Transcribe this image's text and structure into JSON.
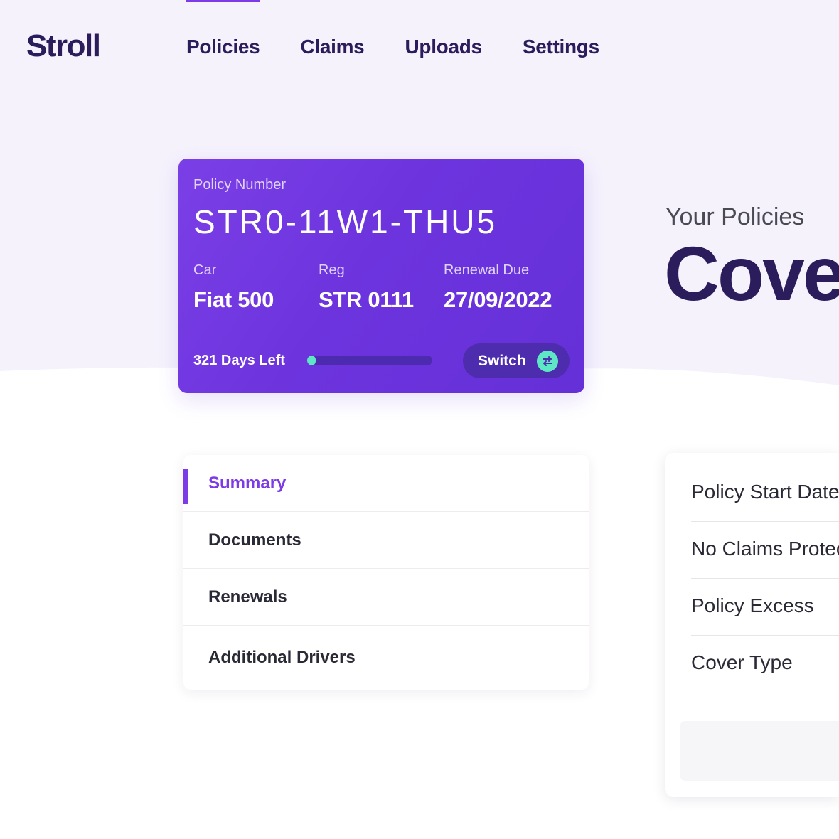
{
  "app": {
    "logo": "Stroll"
  },
  "nav": {
    "items": [
      {
        "label": "Policies",
        "active": true
      },
      {
        "label": "Claims",
        "active": false
      },
      {
        "label": "Uploads",
        "active": false
      },
      {
        "label": "Settings",
        "active": false
      }
    ]
  },
  "policy_card": {
    "number_label": "Policy Number",
    "number": "STR0-11W1-THU5",
    "car_label": "Car",
    "car": "Fiat 500",
    "reg_label": "Reg",
    "reg": "STR 0111",
    "renewal_label": "Renewal Due",
    "renewal": "27/09/2022",
    "days_left": "321 Days Left",
    "progress_fraction": 0.07,
    "switch_label": "Switch",
    "switch_icon": "swap-arrows-icon"
  },
  "hero": {
    "subtitle": "Your Policies",
    "title": "Cove"
  },
  "tabs": {
    "items": [
      {
        "label": "Summary",
        "active": true
      },
      {
        "label": "Documents",
        "active": false
      },
      {
        "label": "Renewals",
        "active": false
      },
      {
        "label": "Additional Drivers",
        "active": false
      }
    ]
  },
  "details": {
    "rows": [
      {
        "label": "Policy Start Date"
      },
      {
        "label": "No Claims Protec"
      },
      {
        "label": "Policy Excess"
      },
      {
        "label": "Cover Type"
      }
    ]
  },
  "colors": {
    "brand_dark": "#2b1d5c",
    "accent": "#7c3be6",
    "card": "#6d34de",
    "teal": "#5ee7c4",
    "hero_bg": "#f5f2fc"
  }
}
